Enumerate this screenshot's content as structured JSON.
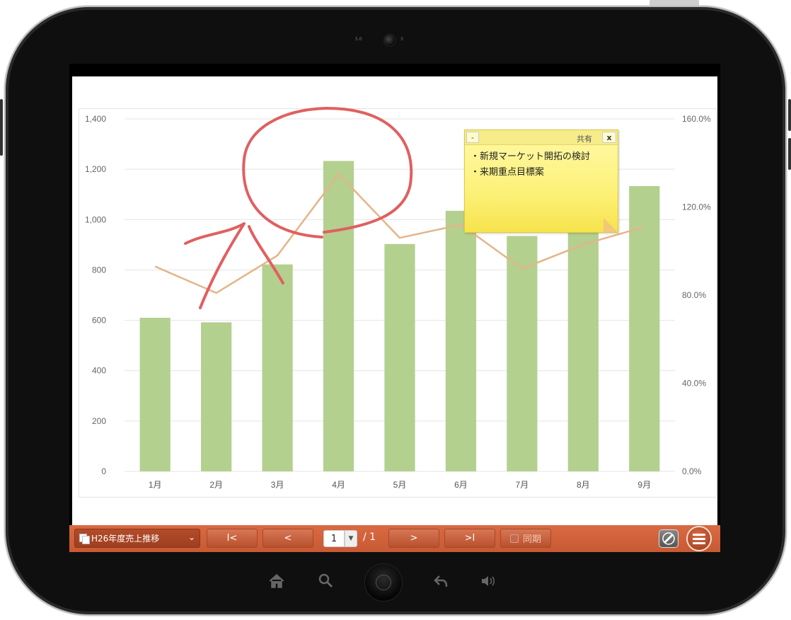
{
  "camera": {
    "left_label": "5.0",
    "right_label": "3"
  },
  "chart_data": {
    "type": "bar+line",
    "categories": [
      "1月",
      "2月",
      "3月",
      "4月",
      "5月",
      "6月",
      "7月",
      "8月",
      "9月"
    ],
    "series": [
      {
        "values": [
          610,
          592,
          822,
          1233,
          903,
          1035,
          935,
          960,
          1133
        ],
        "axis": "left",
        "color": "#b3d08f"
      },
      {
        "values": [
          93,
          81,
          98,
          135,
          106,
          112,
          92,
          103,
          111
        ],
        "axis": "right",
        "color": "#e5b488"
      }
    ],
    "y_left": {
      "min": 0,
      "max": 1400,
      "ticks": [
        "0",
        "200",
        "400",
        "600",
        "800",
        "1,000",
        "1,200",
        "1,400"
      ]
    },
    "y_right": {
      "min": 0,
      "max": 160,
      "ticks": [
        "0.0%",
        "40.0%",
        "80.0%",
        "120.0%",
        "160.0%"
      ]
    },
    "grid": true
  },
  "sticky_note": {
    "minimize_label": "-",
    "share_label": "共有",
    "close_label": "x",
    "lines": [
      "・新規マーケット開拓の検討",
      "・来期重点目標案"
    ]
  },
  "toolbar": {
    "doc_name": "H26年度売上推移",
    "first_label": "I<",
    "prev_label": "<",
    "page_current": "1",
    "page_total": "/ 1",
    "next_label": ">",
    "last_label": ">I",
    "sync_label": "同期"
  },
  "colors": {
    "toolbar": "#c85a33",
    "bar": "#b3d08f",
    "line": "#e5b488",
    "annotation": "#e06060",
    "note": "#fdf17a"
  },
  "bezel_icons": [
    "home-icon",
    "search-icon",
    "home-button",
    "back-icon",
    "volume-icon"
  ]
}
